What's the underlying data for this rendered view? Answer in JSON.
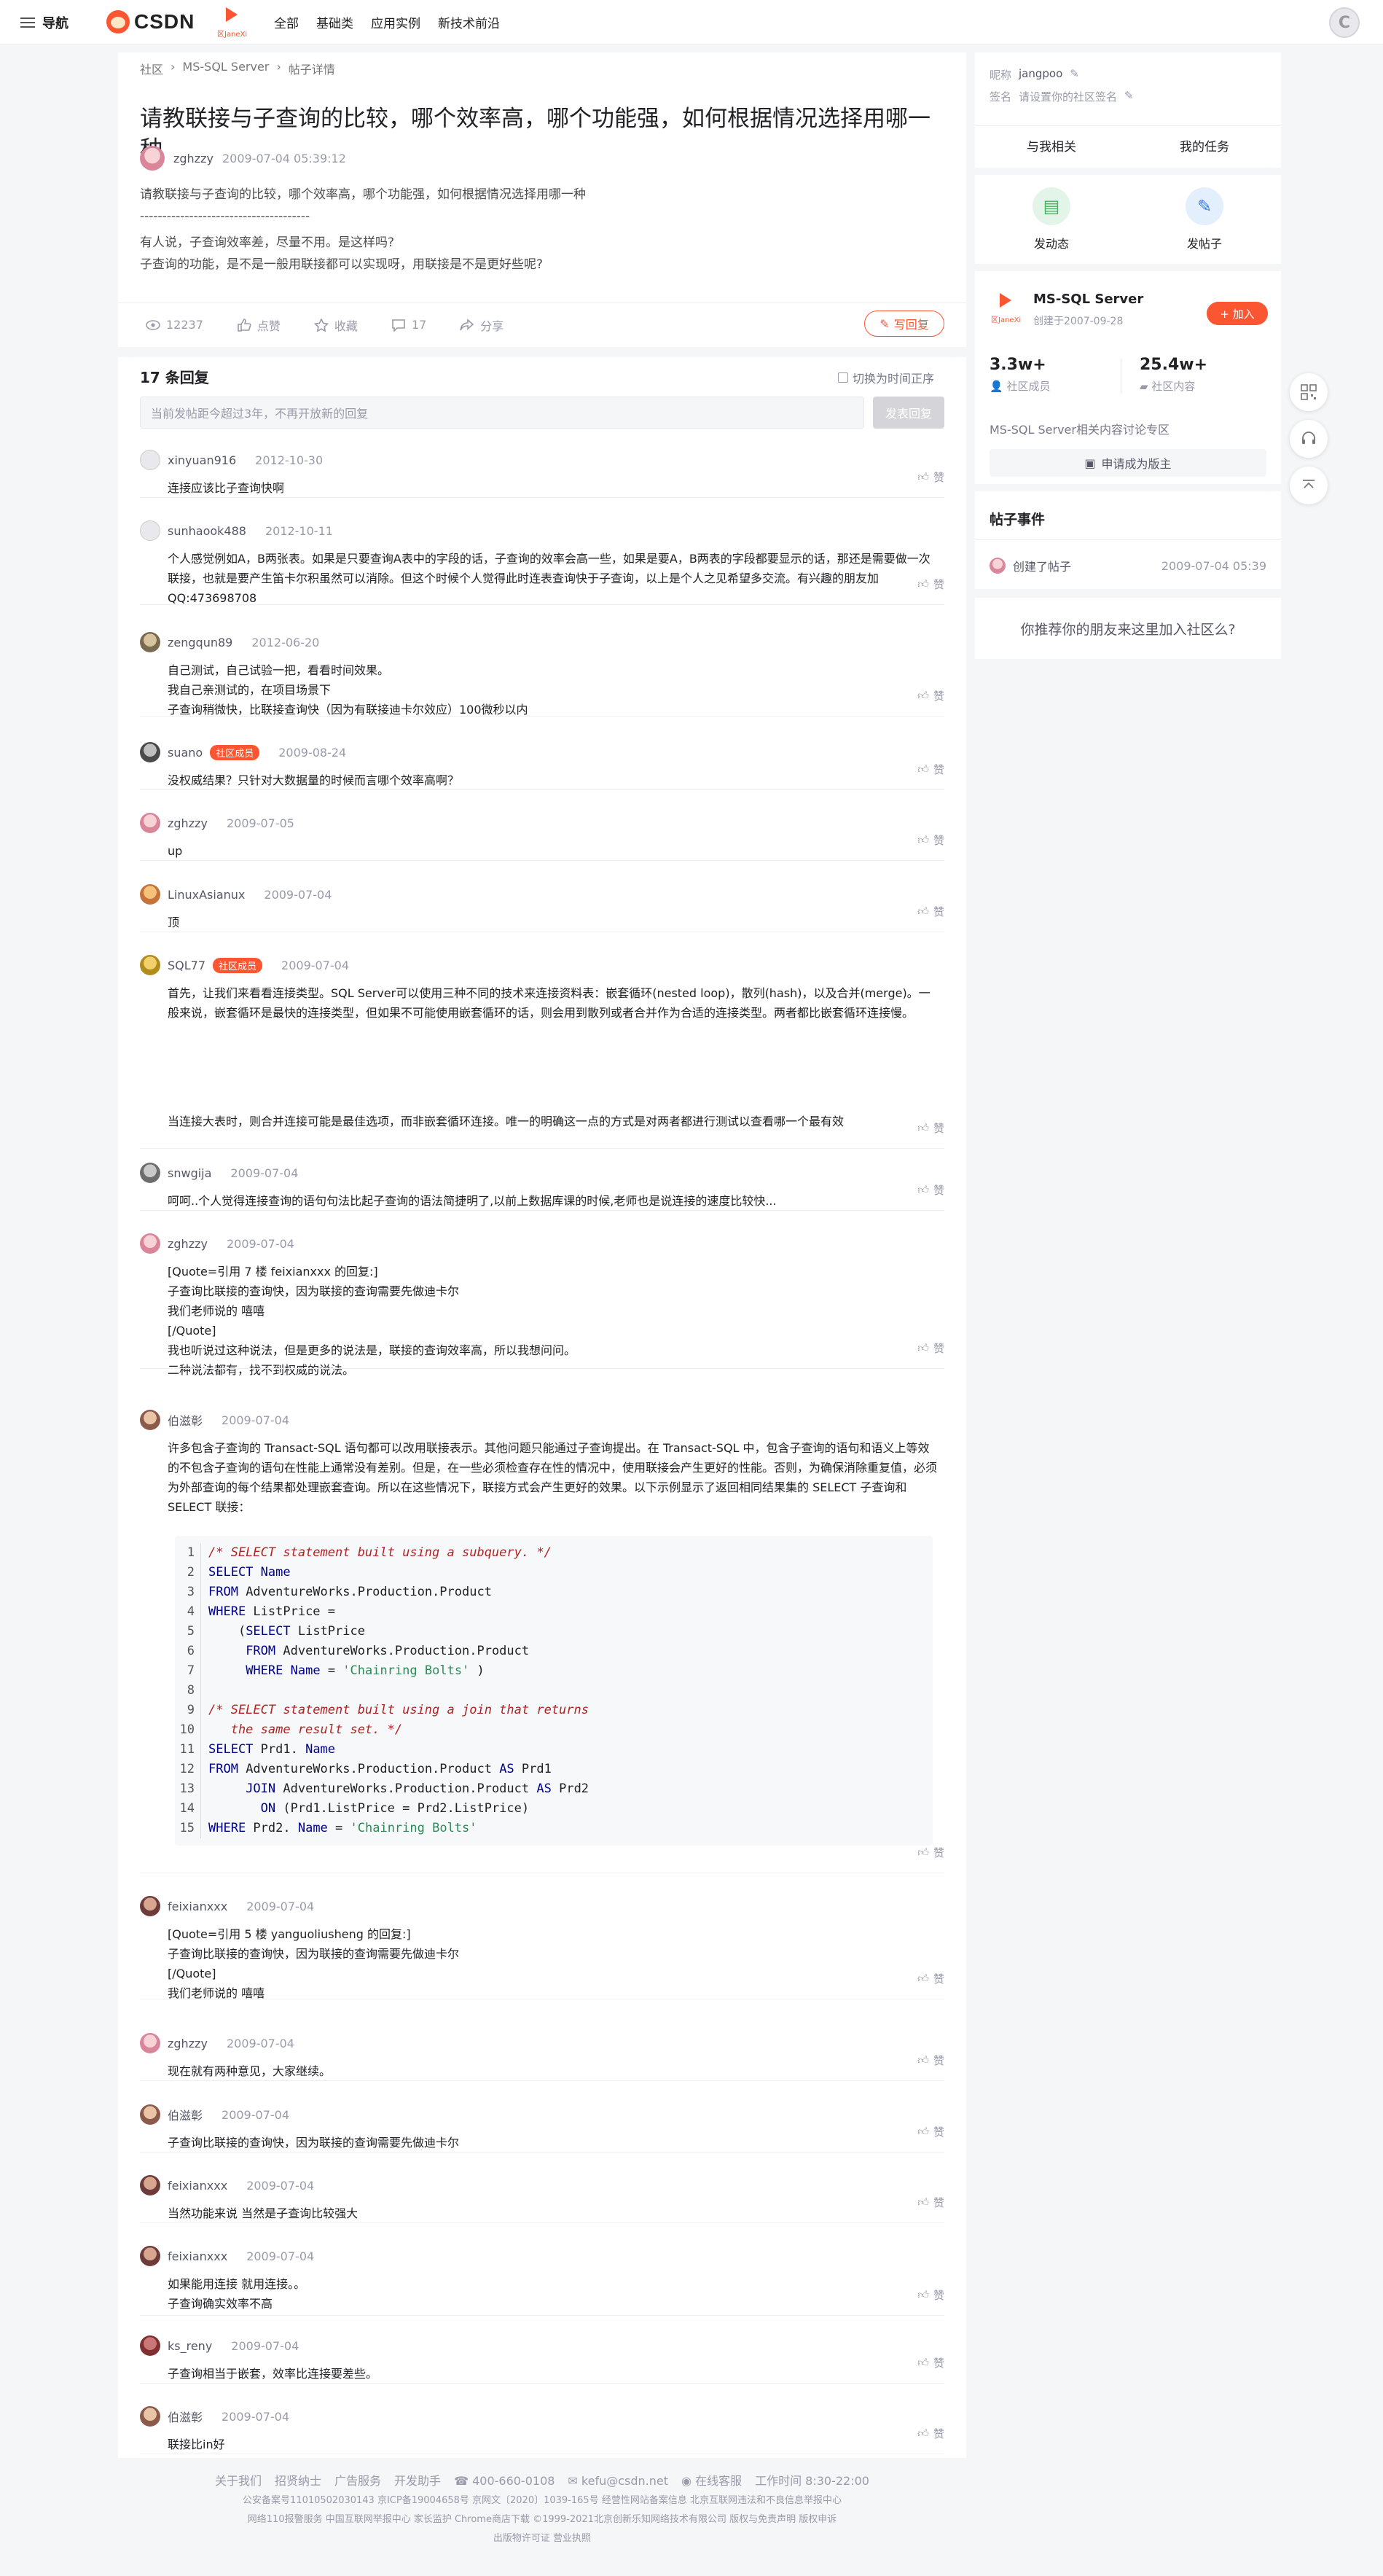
{
  "nav": {
    "menu_label": "导航",
    "logo_text": "CSDN",
    "community_logo_caption": "区JaneXi",
    "links": [
      "全部",
      "基础类",
      "应用实例",
      "新技术前沿"
    ]
  },
  "breadcrumb": [
    "社区",
    "MS-SQL Server",
    "帖子详情"
  ],
  "post": {
    "title": "请教联接与子查询的比较，哪个效率高，哪个功能强，如何根据情况选择用哪一种",
    "author": "zghzzy",
    "time": "2009-07-04 05:39:12",
    "body": [
      "请教联接与子查询的比较，哪个效率高，哪个功能强，如何根据情况选择用哪一种",
      "--------------------------------------",
      "有人说，子查询效率差，尽量不用。是这样吗?",
      "子查询的功能，是不是一般用联接都可以实现呀，用联接是不是更好些呢?"
    ],
    "views": "12237",
    "like_label": "点赞",
    "fav_label": "收藏",
    "comments": "17",
    "share_label": "分享",
    "write_reply": "写回复"
  },
  "replies_section": {
    "count_label": "17 条回复",
    "order_toggle": "切换为时间正序",
    "input_placeholder": "当前发帖距今超过3年，不再开放新的回复",
    "send_label": "发表回复",
    "like_label": "赞",
    "member_badge": "社区成员"
  },
  "replies": [
    {
      "user": "xinyuan916",
      "time": "2012-10-30",
      "lines": [
        "连接应该比子查询快啊"
      ]
    },
    {
      "user": "sunhaook488",
      "time": "2012-10-11",
      "lines": [
        "个人感觉例如A，B两张表。如果是只要查询A表中的字段的话，子查询的效率会高一些，如果是要A，B两表的字段都要显示的话，那还是需要做一次联接，也就是要产生笛卡尔积虽然可以消除。但这个时候个人觉得此时连表查询快于子查询，以上是个人之见希望多交流。有兴趣的朋友加QQ:473698708"
      ]
    },
    {
      "user": "zengqun89",
      "time": "2012-06-20",
      "lines": [
        "自己测试，自己试验一把，看看时间效果。",
        "我自己亲测试的，在项目场景下",
        "子查询稍微快，比联接查询快（因为有联接迪卡尔效应）100微秒以内"
      ]
    },
    {
      "user": "suano",
      "time": "2009-08-24",
      "badge": true,
      "lines": [
        "没权威结果？只针对大数据量的时候而言哪个效率高啊？"
      ]
    },
    {
      "user": "zghzzy",
      "time": "2009-07-05",
      "lines": [
        "up"
      ]
    },
    {
      "user": "LinuxAsianux",
      "time": "2009-07-04",
      "lines": [
        "顶"
      ]
    },
    {
      "user": "SQL77",
      "time": "2009-07-04",
      "badge": true,
      "lines": [
        "首先，让我们来看看连接类型。SQL Server可以使用三种不同的技术来连接资料表：嵌套循环(nested loop)，散列(hash)，以及合并(merge)。一般来说，嵌套循环是最快的连接类型，但如果不可能使用嵌套循环的话，则会用到散列或者合并作为合适的连接类型。两者都比嵌套循环连接慢。",
        "当连接大表时，则合并连接可能是最佳选项，而非嵌套循环连接。唯一的明确这一点的方式是对两者都进行测试以查看哪一个最有效"
      ]
    },
    {
      "user": "snwgija",
      "time": "2009-07-04",
      "lines": [
        "呵呵..个人觉得连接查询的语句句法比起子查询的语法简捷明了,以前上数据库课的时候,老师也是说连接的速度比较快..."
      ]
    },
    {
      "user": "zghzzy",
      "time": "2009-07-04",
      "lines": [
        "[Quote=引用 7 楼 feixianxxx 的回复:]",
        "子查询比联接的查询快，因为联接的查询需要先做迪卡尔",
        "我们老师说的 嘻嘻",
        "[/Quote]",
        "我也听说过这种说法，但是更多的说法是，联接的查询效率高，所以我想问问。",
        "二种说法都有，找不到权威的说法。"
      ]
    },
    {
      "user": "伯滋彰",
      "time": "2009-07-04",
      "lines": [
        "许多包含子查询的 Transact-SQL 语句都可以改用联接表示。其他问题只能通过子查询提出。在 Transact-SQL 中，包含子查询的语句和语义上等效的不包含子查询的语句在性能上通常没有差别。但是，在一些必须检查存在性的情况中，使用联接会产生更好的性能。否则，为确保消除重复值，必须为外部查询的每个结果都处理嵌套查询。所以在这些情况下，联接方式会产生更好的效果。以下示例显示了返回相同结果集的 SELECT 子查询和 SELECT 联接："
      ]
    },
    {
      "user": "feixianxxx",
      "time": "2009-07-04",
      "lines": [
        "[Quote=引用 5 楼 yanguoliusheng 的回复:]",
        "子查询比联接的查询快，因为联接的查询需要先做迪卡尔",
        "[/Quote]",
        "我们老师说的 嘻嘻"
      ]
    },
    {
      "user": "zghzzy",
      "time": "2009-07-04",
      "lines": [
        "现在就有两种意见，大家继续。"
      ]
    },
    {
      "user": "伯滋彰",
      "time": "2009-07-04",
      "lines": [
        "子查询比联接的查询快，因为联接的查询需要先做迪卡尔"
      ]
    },
    {
      "user": "feixianxxx",
      "time": "2009-07-04",
      "lines": [
        "当然功能来说 当然是子查询比较强大"
      ]
    },
    {
      "user": "feixianxxx",
      "time": "2009-07-04",
      "lines": [
        "如果能用连接 就用连接。。",
        "子查询确实效率不高"
      ]
    },
    {
      "user": "ks_reny",
      "time": "2009-07-04",
      "lines": [
        "子查询相当于嵌套，效率比连接要差些。"
      ]
    },
    {
      "user": "伯滋彰",
      "time": "2009-07-04",
      "lines": [
        "联接比in好"
      ]
    }
  ],
  "code_lines": [
    "/* SELECT statement built using a subquery. */",
    "SELECT Name",
    "FROM AdventureWorks.Production.Product",
    "WHERE ListPrice =",
    "    (SELECT ListPrice",
    "     FROM AdventureWorks.Production.Product",
    "     WHERE Name = 'Chainring Bolts' )",
    "",
    "/* SELECT statement built using a join that returns",
    "   the same result set. */",
    "SELECT Prd1. Name",
    "FROM AdventureWorks.Production.Product AS Prd1",
    "     JOIN AdventureWorks.Production.Product AS Prd2",
    "       ON (Prd1.ListPrice = Prd2.ListPrice)",
    "WHERE Prd2. Name = 'Chainring Bolts'"
  ],
  "sidebar": {
    "nick_label": "昵称",
    "nick": "jangpoo",
    "sign_label": "签名",
    "sign": "请设置你的社区签名",
    "tab_related": "与我相关",
    "tab_tasks": "我的任务",
    "action_dynamic": "发动态",
    "action_post": "发帖子",
    "community_name": "MS-SQL Server",
    "community_created": "创建于2007-09-28",
    "join_label": "+ 加入",
    "members_count": "3.3w+",
    "members_label": "社区成员",
    "content_count": "25.4w+",
    "content_label": "社区内容",
    "community_desc": "MS-SQL Server相关内容讨论专区",
    "apply_label": "申请成为版主",
    "events_title": "帖子事件",
    "event_text": "创建了帖子",
    "event_time": "2009-07-04 05:39",
    "recommend_text": "你推荐你的朋友来这里加入社区么?"
  },
  "footer": {
    "links": [
      "关于我们",
      "招贤纳士",
      "广告服务",
      "开发助手",
      "400-660-0108",
      "kefu@csdn.net",
      "在线客服",
      "工作时间 8:30-22:00"
    ],
    "line2": "公安备案号11010502030143 京ICP备19004658号 京网文〔2020〕1039-165号 经营性网站备案信息 北京互联网违法和不良信息举报中心",
    "line3": "网络110报警服务 中国互联网举报中心 家长监护 Chrome商店下载 ©1999-2021北京创新乐知网络技术有限公司 版权与免责声明 版权申诉",
    "line4": "出版物许可证 营业执照"
  }
}
